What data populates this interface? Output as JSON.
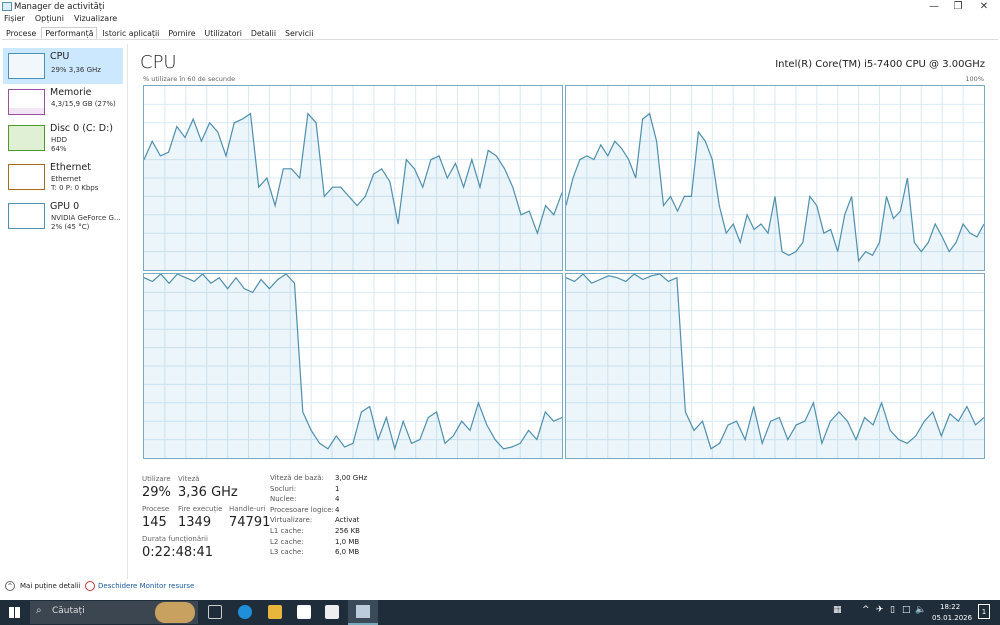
{
  "window": {
    "title": "Manager de activități",
    "icon": "task-manager-icon",
    "controls": [
      "minimize",
      "maximize",
      "close"
    ]
  },
  "menu": [
    "Fișier",
    "Opțiuni",
    "Vizualizare"
  ],
  "tabs": [
    {
      "label": "Procese"
    },
    {
      "label": "Performanță",
      "active": true
    },
    {
      "label": "Istoric aplicații"
    },
    {
      "label": "Pornire"
    },
    {
      "label": "Utilizatori"
    },
    {
      "label": "Detalii"
    },
    {
      "label": "Servicii"
    }
  ],
  "sidebar": [
    {
      "name": "CPU",
      "line1": "29% 3,36 GHz",
      "line2": "",
      "color": "#4a90b8"
    },
    {
      "name": "Memorie",
      "line1": "4,3/15,9 GB (27%)",
      "line2": "",
      "color": "#9b4fa0"
    },
    {
      "name": "Disc 0 (C: D:)",
      "line1": "HDD",
      "line2": "64%",
      "color": "#4c9a2a"
    },
    {
      "name": "Ethernet",
      "line1": "Ethernet",
      "line2": "T: 0 P: 0 Kbps",
      "color": "#a86a1c"
    },
    {
      "name": "GPU 0",
      "line1": "NVIDIA GeForce G...",
      "line2": "2% (45 °C)",
      "color": "#4a90b8"
    }
  ],
  "main": {
    "title": "CPU",
    "model": "Intel(R) Core(TM) i5-7400 CPU @ 3.00GHz",
    "util_label": "% utilizare în 60 de secunde",
    "max_label": "100%",
    "stats": {
      "utilizare_label": "Utilizare",
      "utilizare": "29%",
      "viteza_label": "Viteză",
      "viteza": "3,36 GHz",
      "procese_label": "Procese",
      "procese": "145",
      "fire_label": "Fire execuție",
      "fire": "1349",
      "handle_label": "Handle-uri",
      "handle": "74791",
      "durata_label": "Durata funcționării",
      "durata": "0:22:48:41"
    },
    "specs": [
      {
        "k": "Viteză de bază:",
        "v": "3,00 GHz"
      },
      {
        "k": "Socluri:",
        "v": "1"
      },
      {
        "k": "Nuclee:",
        "v": "4"
      },
      {
        "k": "Procesoare logice:",
        "v": "4"
      },
      {
        "k": "Virtualizare:",
        "v": "Activat"
      },
      {
        "k": "L1 cache:",
        "v": "256 KB"
      },
      {
        "k": "L2 cache:",
        "v": "1,0 MB"
      },
      {
        "k": "L3 cache:",
        "v": "6,0 MB"
      }
    ]
  },
  "footer": {
    "less": "Mai puține detalii",
    "monitor": "Deschidere Monitor resurse"
  },
  "taskbar": {
    "search_placeholder": "Căutați",
    "time": "18:22",
    "date": "05.01.2026",
    "notif": "1"
  },
  "chart_data": {
    "type": "line",
    "ylim": [
      0,
      100
    ],
    "series": [
      {
        "name": "core-0",
        "values": [
          60,
          70,
          62,
          64,
          78,
          72,
          82,
          70,
          80,
          75,
          62,
          80,
          82,
          85,
          45,
          50,
          35,
          55,
          55,
          50,
          85,
          80,
          40,
          45,
          45,
          40,
          35,
          40,
          52,
          55,
          48,
          25,
          60,
          55,
          45,
          60,
          62,
          50,
          58,
          45,
          60,
          45,
          65,
          62,
          55,
          45,
          30,
          32,
          20,
          35,
          30,
          42
        ]
      },
      {
        "name": "core-1",
        "values": [
          35,
          50,
          60,
          62,
          60,
          68,
          62,
          70,
          66,
          60,
          50,
          82,
          85,
          70,
          35,
          40,
          32,
          40,
          40,
          75,
          70,
          60,
          35,
          20,
          25,
          15,
          30,
          22,
          25,
          20,
          40,
          10,
          8,
          10,
          15,
          40,
          35,
          20,
          22,
          10,
          30,
          40,
          5,
          10,
          8,
          15,
          40,
          28,
          32,
          50,
          15,
          10,
          15,
          25,
          18,
          10,
          15,
          25,
          20,
          18,
          25
        ]
      },
      {
        "name": "core-2",
        "values": [
          98,
          96,
          100,
          95,
          100,
          98,
          96,
          100,
          95,
          98,
          92,
          98,
          92,
          90,
          97,
          92,
          97,
          100,
          95,
          25,
          15,
          8,
          5,
          12,
          6,
          8,
          25,
          28,
          10,
          22,
          5,
          20,
          8,
          10,
          22,
          25,
          8,
          12,
          20,
          15,
          30,
          18,
          10,
          5,
          6,
          8,
          15,
          10,
          25,
          20,
          22
        ]
      },
      {
        "name": "core-3",
        "values": [
          98,
          96,
          100,
          95,
          97,
          99,
          98,
          96,
          100,
          97,
          99,
          100,
          96,
          98,
          25,
          15,
          20,
          5,
          8,
          18,
          20,
          10,
          28,
          8,
          20,
          22,
          10,
          18,
          20,
          30,
          8,
          20,
          25,
          20,
          10,
          22,
          18,
          30,
          15,
          10,
          8,
          12,
          20,
          25,
          12,
          24,
          20,
          28,
          18,
          22
        ]
      }
    ]
  }
}
